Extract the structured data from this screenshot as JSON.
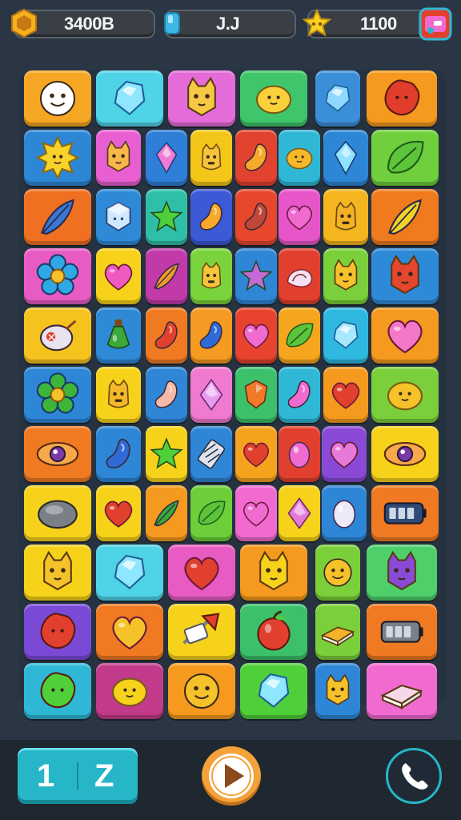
{
  "hud": {
    "coins": {
      "icon": "gold-hexagon-icon",
      "value": "3400B"
    },
    "moves": {
      "icon": "blue-gem-icon",
      "value": "J.J"
    },
    "stars": {
      "icon": "star-icon",
      "value": "1100"
    },
    "shop_icon": "treasure-chest-icon"
  },
  "board": {
    "tiles": [
      {
        "bg": "#f5a623",
        "icon": "face-icon",
        "c": "#ffffff"
      },
      {
        "bg": "#4fd3e6",
        "icon": "gem-icon",
        "c": "#8fe6ff"
      },
      {
        "bg": "#e46bd8",
        "icon": "cat-icon",
        "c": "#f7c843"
      },
      {
        "bg": "#3fc66a",
        "icon": "lemon-icon",
        "c": "#f8d13b"
      },
      {
        "bg": "#3b8fd9",
        "icon": "gem-icon",
        "c": "#8fd8ff"
      },
      {
        "bg": "#f59a1e",
        "icon": "blob-icon",
        "c": "#e23d2b"
      },
      {
        "bg": "#2e86d6",
        "icon": "sun-icon",
        "c": "#f9d22a"
      },
      {
        "bg": "#e75fd0",
        "icon": "cat-icon",
        "c": "#f6b84b"
      },
      {
        "bg": "#2f7fd8",
        "icon": "crystal-icon",
        "c": "#f07ad6"
      },
      {
        "bg": "#f5c61a",
        "icon": "monster-icon",
        "c": "#f6c33b"
      },
      {
        "bg": "#e2432f",
        "icon": "bean-icon",
        "c": "#f7a92a"
      },
      {
        "bg": "#2fb8d6",
        "icon": "lemon-icon",
        "c": "#f6b82b"
      },
      {
        "bg": "#2e86d6",
        "icon": "crystal-icon",
        "c": "#8fe3ff"
      },
      {
        "bg": "#6fcf3c",
        "icon": "leaf-icon",
        "c": "#5ec43a"
      },
      {
        "bg": "#f07022",
        "icon": "feather-icon",
        "c": "#3a76d6"
      },
      {
        "bg": "#2e8ad6",
        "icon": "cube-icon",
        "c": "#cfe8ff"
      },
      {
        "bg": "#2fbfa8",
        "icon": "star-icon",
        "c": "#4fcf3a"
      },
      {
        "bg": "#3c59d6",
        "icon": "bean-icon",
        "c": "#f6a92a"
      },
      {
        "bg": "#e6472d",
        "icon": "bean-icon",
        "c": "#c0483a"
      },
      {
        "bg": "#e756c8",
        "icon": "heart-icon",
        "c": "#f06ad0"
      },
      {
        "bg": "#f5b51e",
        "icon": "monster-icon",
        "c": "#f2b224"
      },
      {
        "bg": "#f07a1e",
        "icon": "feather-icon",
        "c": "#f2d22a"
      },
      {
        "bg": "#e85bc2",
        "icon": "flower-icon",
        "c": "#2fa8e6"
      },
      {
        "bg": "#f6d21a",
        "icon": "heart-icon",
        "c": "#f05ac0"
      },
      {
        "bg": "#c23aa8",
        "icon": "feather-icon",
        "c": "#f59a2a"
      },
      {
        "bg": "#7bd33c",
        "icon": "monster-icon",
        "c": "#f5c43a"
      },
      {
        "bg": "#2f86d6",
        "icon": "star-icon",
        "c": "#c36ad8"
      },
      {
        "bg": "#e2402e",
        "icon": "shell-icon",
        "c": "#f3e2f0"
      },
      {
        "bg": "#7bcf3a",
        "icon": "cat-icon",
        "c": "#f6c22a"
      },
      {
        "bg": "#2d8ad8",
        "icon": "cat-icon",
        "c": "#e4462e"
      },
      {
        "bg": "#f6c21e",
        "icon": "bomb-icon",
        "c": "#e9e3ef"
      },
      {
        "bg": "#2e8ad6",
        "icon": "potion-icon",
        "c": "#3aa83a"
      },
      {
        "bg": "#f07a22",
        "icon": "bean-icon",
        "c": "#e2402e"
      },
      {
        "bg": "#f59a22",
        "icon": "bean-icon",
        "c": "#2f6ad6"
      },
      {
        "bg": "#e7432e",
        "icon": "heart-icon",
        "c": "#f06ad0"
      },
      {
        "bg": "#f5a61e",
        "icon": "leaf-icon",
        "c": "#5cc43a"
      },
      {
        "bg": "#2fb8e0",
        "icon": "gem-icon",
        "c": "#a8e8ff"
      },
      {
        "bg": "#f59a1e",
        "icon": "heart-icon",
        "c": "#f577c8"
      },
      {
        "bg": "#2e86d6",
        "icon": "flower-icon",
        "c": "#3cb53a"
      },
      {
        "bg": "#f6d21a",
        "icon": "monster-icon",
        "c": "#f5b82a"
      },
      {
        "bg": "#2f86d6",
        "icon": "bean-icon",
        "c": "#f6b8a8"
      },
      {
        "bg": "#f07ad0",
        "icon": "diamond-icon",
        "c": "#e79cf2"
      },
      {
        "bg": "#3cc06a",
        "icon": "shield-icon",
        "c": "#f07a2a"
      },
      {
        "bg": "#2fb8d6",
        "icon": "bean-icon",
        "c": "#f06ad0"
      },
      {
        "bg": "#f59a1e",
        "icon": "heart-icon",
        "c": "#e2402e"
      },
      {
        "bg": "#7bcf3a",
        "icon": "lemon-icon",
        "c": "#f6c22a"
      },
      {
        "bg": "#f07a22",
        "icon": "eye-icon",
        "c": "#7a3aa8"
      },
      {
        "bg": "#2e86d6",
        "icon": "bean-icon",
        "c": "#2f6ad6"
      },
      {
        "bg": "#f6d21a",
        "icon": "star-icon",
        "c": "#4fcf3a"
      },
      {
        "bg": "#2f86d6",
        "icon": "candy-icon",
        "c": "#dde3ee"
      },
      {
        "bg": "#f5a21e",
        "icon": "heart-icon",
        "c": "#e2402e"
      },
      {
        "bg": "#e2402e",
        "icon": "egg-icon",
        "c": "#f06ad0"
      },
      {
        "bg": "#8a4ad6",
        "icon": "heart-icon",
        "c": "#e67ad6"
      },
      {
        "bg": "#f6d21a",
        "icon": "eye-icon",
        "c": "#7a3aa8"
      },
      {
        "bg": "#f6d21a",
        "icon": "stone-icon",
        "c": "#7a7f88"
      },
      {
        "bg": "#f6d21a",
        "icon": "heart-icon",
        "c": "#e2402e"
      },
      {
        "bg": "#f59a1e",
        "icon": "feather-icon",
        "c": "#3aa83a"
      },
      {
        "bg": "#6ccf3a",
        "icon": "leaf-icon",
        "c": "#5cc43a"
      },
      {
        "bg": "#f06ad0",
        "icon": "heart-icon",
        "c": "#f06ad0"
      },
      {
        "bg": "#f6d21a",
        "icon": "diamond-icon",
        "c": "#e67ad6"
      },
      {
        "bg": "#2e86d6",
        "icon": "egg-icon",
        "c": "#eceaf6"
      },
      {
        "bg": "#f07a22",
        "icon": "battery-icon",
        "c": "#2f4a78"
      },
      {
        "bg": "#f6d21a",
        "icon": "cat-icon",
        "c": "#f6c22a"
      },
      {
        "bg": "#4fd3e6",
        "icon": "gem-icon",
        "c": "#8fe6ff"
      },
      {
        "bg": "#e85bc2",
        "icon": "heart-icon",
        "c": "#e2402e"
      },
      {
        "bg": "#f59a1e",
        "icon": "cat-icon",
        "c": "#f6d21a"
      },
      {
        "bg": "#7bcf3a",
        "icon": "face-icon",
        "c": "#f6c22a"
      },
      {
        "bg": "#4fcf6a",
        "icon": "cat-icon",
        "c": "#8a4ad6"
      },
      {
        "bg": "#7a4ad6",
        "icon": "blob-icon",
        "c": "#e2402e"
      },
      {
        "bg": "#f07a22",
        "icon": "heart-icon",
        "c": "#f6c22a"
      },
      {
        "bg": "#f6d21a",
        "icon": "arrow-icon",
        "c": "#e2402e"
      },
      {
        "bg": "#3cc06a",
        "icon": "apple-icon",
        "c": "#e2402e"
      },
      {
        "bg": "#7bcf3a",
        "icon": "book-icon",
        "c": "#f6b22a"
      },
      {
        "bg": "#f07a22",
        "icon": "battery-icon",
        "c": "#7a7f88"
      },
      {
        "bg": "#2fb8d6",
        "icon": "blob-icon",
        "c": "#4fcf3a"
      },
      {
        "bg": "#c23a8a",
        "icon": "lemon-icon",
        "c": "#f6d21a"
      },
      {
        "bg": "#f59a1e",
        "icon": "face-icon",
        "c": "#f6c22a"
      },
      {
        "bg": "#4fcf3a",
        "icon": "gem-icon",
        "c": "#8fe6ff"
      },
      {
        "bg": "#2e86d6",
        "icon": "cat-icon",
        "c": "#f6c22a"
      },
      {
        "bg": "#f06ad0",
        "icon": "book-icon",
        "c": "#f6d8e8"
      }
    ]
  },
  "controls": {
    "level_left": "1",
    "level_right": "Z",
    "play_icon": "play-icon",
    "phone_icon": "phone-icon",
    "colors": {
      "accent": "#27b6c8",
      "play": "#f4a23a"
    }
  }
}
